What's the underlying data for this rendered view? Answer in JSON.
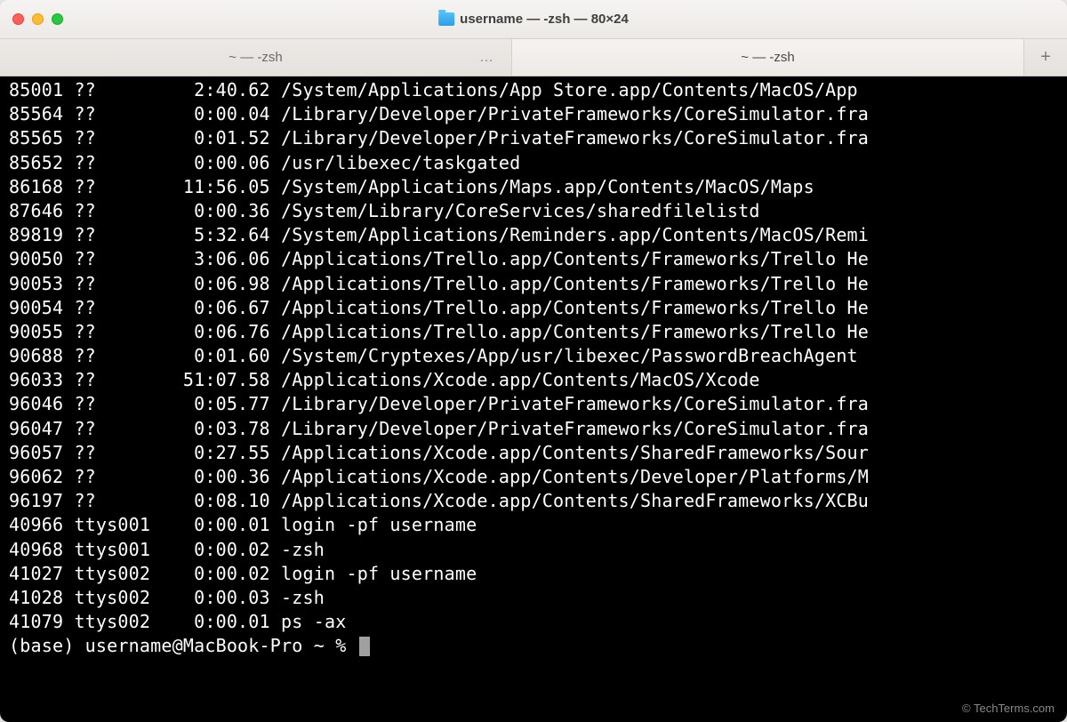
{
  "window": {
    "title": "username — -zsh — 80×24"
  },
  "tabs": [
    {
      "label": "~ — -zsh",
      "active": false,
      "hasEllipsis": true
    },
    {
      "label": "~ — -zsh",
      "active": true,
      "hasEllipsis": false
    }
  ],
  "processes": [
    {
      "pid": "85001",
      "tty": "??",
      "time": "2:40.62",
      "cmd": "/System/Applications/App Store.app/Contents/MacOS/App"
    },
    {
      "pid": "85564",
      "tty": "??",
      "time": "0:00.04",
      "cmd": "/Library/Developer/PrivateFrameworks/CoreSimulator.fra"
    },
    {
      "pid": "85565",
      "tty": "??",
      "time": "0:01.52",
      "cmd": "/Library/Developer/PrivateFrameworks/CoreSimulator.fra"
    },
    {
      "pid": "85652",
      "tty": "??",
      "time": "0:00.06",
      "cmd": "/usr/libexec/taskgated"
    },
    {
      "pid": "86168",
      "tty": "??",
      "time": "11:56.05",
      "cmd": "/System/Applications/Maps.app/Contents/MacOS/Maps"
    },
    {
      "pid": "87646",
      "tty": "??",
      "time": "0:00.36",
      "cmd": "/System/Library/CoreServices/sharedfilelistd"
    },
    {
      "pid": "89819",
      "tty": "??",
      "time": "5:32.64",
      "cmd": "/System/Applications/Reminders.app/Contents/MacOS/Remi"
    },
    {
      "pid": "90050",
      "tty": "??",
      "time": "3:06.06",
      "cmd": "/Applications/Trello.app/Contents/Frameworks/Trello He"
    },
    {
      "pid": "90053",
      "tty": "??",
      "time": "0:06.98",
      "cmd": "/Applications/Trello.app/Contents/Frameworks/Trello He"
    },
    {
      "pid": "90054",
      "tty": "??",
      "time": "0:06.67",
      "cmd": "/Applications/Trello.app/Contents/Frameworks/Trello He"
    },
    {
      "pid": "90055",
      "tty": "??",
      "time": "0:06.76",
      "cmd": "/Applications/Trello.app/Contents/Frameworks/Trello He"
    },
    {
      "pid": "90688",
      "tty": "??",
      "time": "0:01.60",
      "cmd": "/System/Cryptexes/App/usr/libexec/PasswordBreachAgent"
    },
    {
      "pid": "96033",
      "tty": "??",
      "time": "51:07.58",
      "cmd": "/Applications/Xcode.app/Contents/MacOS/Xcode"
    },
    {
      "pid": "96046",
      "tty": "??",
      "time": "0:05.77",
      "cmd": "/Library/Developer/PrivateFrameworks/CoreSimulator.fra"
    },
    {
      "pid": "96047",
      "tty": "??",
      "time": "0:03.78",
      "cmd": "/Library/Developer/PrivateFrameworks/CoreSimulator.fra"
    },
    {
      "pid": "96057",
      "tty": "??",
      "time": "0:27.55",
      "cmd": "/Applications/Xcode.app/Contents/SharedFrameworks/Sour"
    },
    {
      "pid": "96062",
      "tty": "??",
      "time": "0:00.36",
      "cmd": "/Applications/Xcode.app/Contents/Developer/Platforms/M"
    },
    {
      "pid": "96197",
      "tty": "??",
      "time": "0:08.10",
      "cmd": "/Applications/Xcode.app/Contents/SharedFrameworks/XCBu"
    },
    {
      "pid": "40966",
      "tty": "ttys001",
      "time": "0:00.01",
      "cmd": "login -pf username"
    },
    {
      "pid": "40968",
      "tty": "ttys001",
      "time": "0:00.02",
      "cmd": "-zsh"
    },
    {
      "pid": "41027",
      "tty": "ttys002",
      "time": "0:00.02",
      "cmd": "login -pf username"
    },
    {
      "pid": "41028",
      "tty": "ttys002",
      "time": "0:00.03",
      "cmd": "-zsh"
    },
    {
      "pid": "41079",
      "tty": "ttys002",
      "time": "0:00.01",
      "cmd": "ps -ax"
    }
  ],
  "prompt": "(base) username@MacBook-Pro ~ % ",
  "watermark": "© TechTerms.com",
  "newTabLabel": "+"
}
